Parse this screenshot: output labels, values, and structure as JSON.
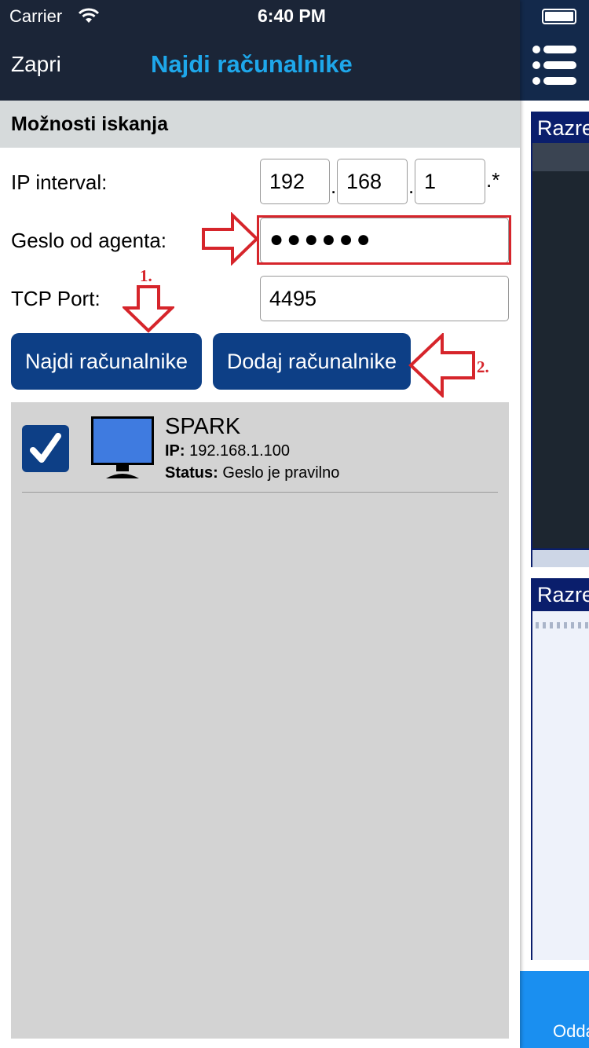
{
  "status_bar": {
    "carrier": "Carrier",
    "time": "6:40 PM"
  },
  "nav": {
    "close_label": "Zapri",
    "title": "Najdi računalnike"
  },
  "section": {
    "title": "Možnosti iskanja"
  },
  "form": {
    "ip_label": "IP interval:",
    "ip_octet_1": "192",
    "ip_octet_2": "168",
    "ip_octet_3": "1",
    "ip_sep": ".",
    "ip_wildcard": ".*",
    "password_label": "Geslo od agenta:",
    "password_value": "●●●●●●",
    "port_label": "TCP Port:",
    "port_value": "4495"
  },
  "buttons": {
    "find": "Najdi računalnike",
    "add": "Dodaj računalnike"
  },
  "annotations": {
    "step1": "1.",
    "step2": "2."
  },
  "results": [
    {
      "name": "SPARK",
      "ip_label": "IP:",
      "ip": "192.168.1.100",
      "status_label": "Status:",
      "status": "Geslo je pravilno",
      "checked": true
    }
  ],
  "background_app": {
    "card_title_1": "Razre",
    "card_title_2": "Razre",
    "bottom_label": "Odda"
  },
  "colors": {
    "nav_bg": "#1b2537",
    "title_accent": "#1ea7ea",
    "button_bg": "#0d3f86",
    "annotation_red": "#d6252b",
    "results_bg": "#d3d3d3"
  },
  "icons": [
    "wifi-icon",
    "battery-icon",
    "list-menu-icon",
    "checkbox-checked-icon",
    "monitor-icon",
    "arrow-right-icon",
    "arrow-down-icon",
    "arrow-left-icon"
  ]
}
